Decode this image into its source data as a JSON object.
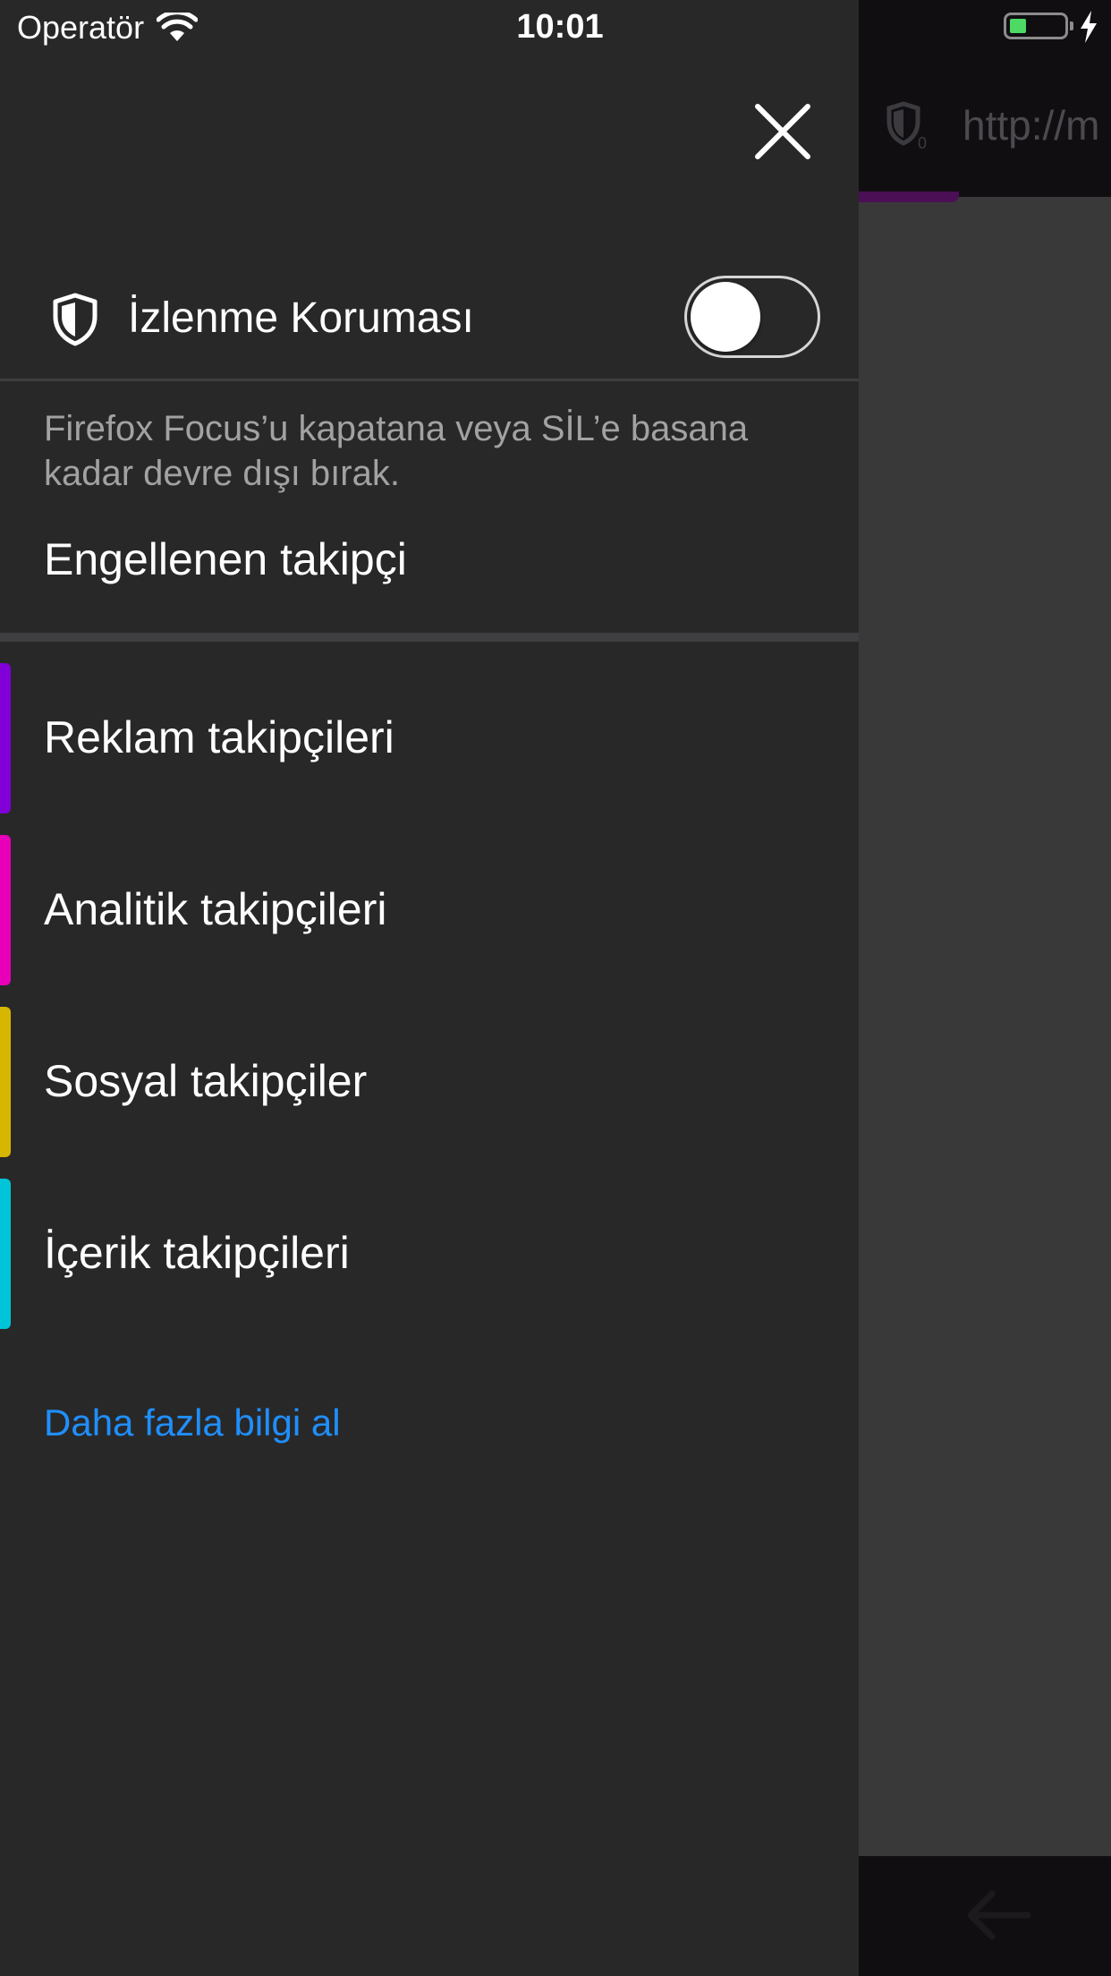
{
  "status_bar": {
    "carrier": "Operatör",
    "time": "10:01",
    "battery_color": "#4cd964"
  },
  "background_browser": {
    "url_text": "http://m",
    "shield_badge": "0"
  },
  "panel": {
    "close_icon": "close-icon",
    "tracking_protection": {
      "icon": "shield-icon",
      "label": "İzlenme Koruması",
      "toggle_on": false
    },
    "description": "Firefox Focus’u kapatana veya SİL’e basana kadar devre dışı bırak.",
    "blocked_trackers": {
      "label": "Engellenen takipçi",
      "count": ""
    },
    "trackers": [
      {
        "label": "Reklam takipçileri",
        "count": "",
        "color": "#8000d7"
      },
      {
        "label": "Analitik takipçileri",
        "count": "",
        "color": "#e800b8"
      },
      {
        "label": "Sosyal takipçiler",
        "count": "",
        "color": "#d7b600"
      },
      {
        "label": "İçerik takipçileri",
        "count": "",
        "color": "#00c4d7"
      }
    ],
    "learn_more": "Daha fazla bilgi al",
    "accent_color": "#1f8fff"
  }
}
